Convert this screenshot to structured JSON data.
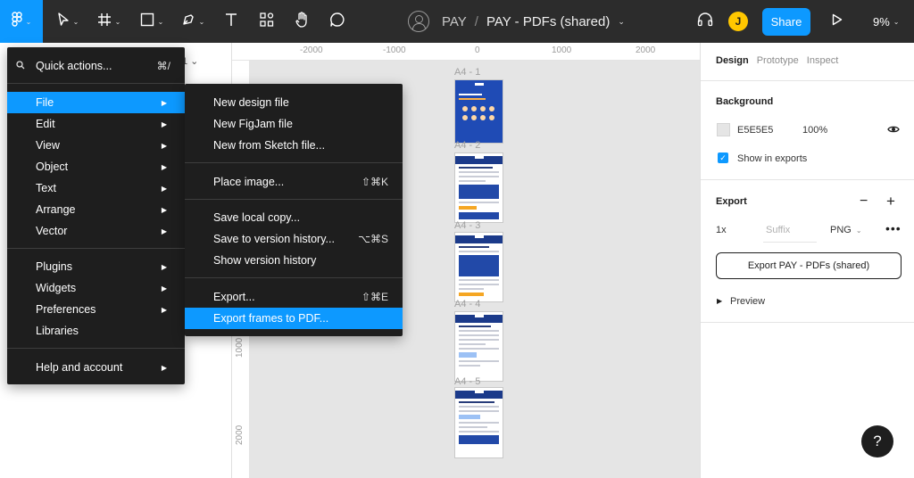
{
  "toolbar": {
    "zoom": "9%",
    "share_label": "Share",
    "user_initial": "J",
    "project": "PAY",
    "separator": "/",
    "file_name": "PAY - PDFs (shared)",
    "icons": [
      "figma-menu-icon",
      "move-tool-icon",
      "frame-tool-icon",
      "shape-tool-icon",
      "pen-tool-icon",
      "text-tool-icon",
      "resources-icon",
      "hand-tool-icon",
      "comment-icon",
      "headphones-icon",
      "play-icon"
    ]
  },
  "left_panel": {
    "peek_text": "1 ⌄"
  },
  "rulers": {
    "top": [
      "-2000",
      "-1000",
      "0",
      "1000",
      "2000"
    ],
    "left": [
      "1000",
      "2000"
    ]
  },
  "frames": [
    "A4 - 1",
    "A4 - 2",
    "A4 - 3",
    "A4 - 4",
    "A4 - 5"
  ],
  "main_menu": {
    "quick_actions": {
      "label": "Quick actions...",
      "shortcut": "⌘/"
    },
    "group1": [
      "File",
      "Edit",
      "View",
      "Object",
      "Text",
      "Arrange",
      "Vector"
    ],
    "group2": [
      "Plugins",
      "Widgets",
      "Preferences",
      "Libraries"
    ],
    "group3": [
      "Help and account"
    ]
  },
  "file_menu": {
    "new_design": "New design file",
    "new_figjam": "New FigJam file",
    "new_sketch": "New from Sketch file...",
    "place_image": "Place image...",
    "place_image_shortcut": "⇧⌘K",
    "save_local": "Save local copy...",
    "save_version": "Save to version history...",
    "save_version_shortcut": "⌥⌘S",
    "show_version": "Show version history",
    "export": "Export...",
    "export_shortcut": "⇧⌘E",
    "export_pdf": "Export frames to PDF..."
  },
  "right_panel": {
    "tabs": [
      "Design",
      "Prototype",
      "Inspect"
    ],
    "background_title": "Background",
    "bg_hex": "E5E5E5",
    "bg_opacity": "100%",
    "show_in_exports": "Show in exports",
    "export_title": "Export",
    "scale": "1x",
    "suffix_placeholder": "Suffix",
    "format": "PNG",
    "export_button": "Export PAY - PDFs (shared)",
    "preview": "Preview"
  },
  "help_label": "?"
}
